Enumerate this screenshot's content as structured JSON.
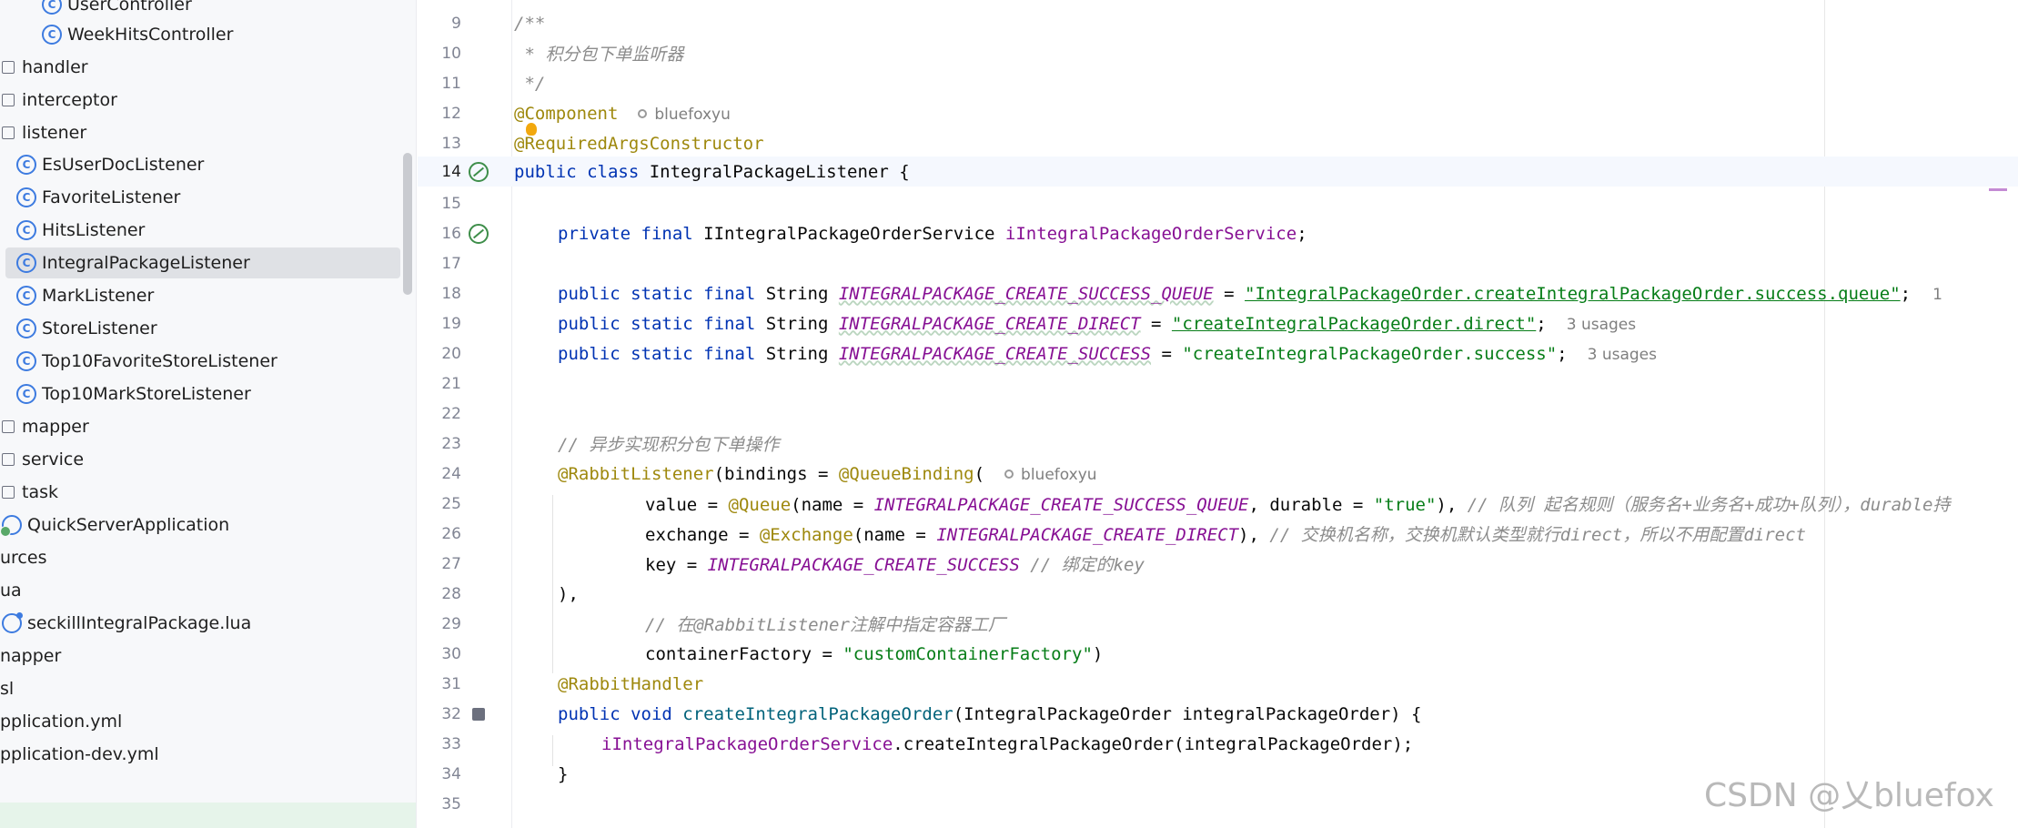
{
  "tree": {
    "items": [
      {
        "label": "UserController",
        "type": "class"
      },
      {
        "label": "WeekHitsController",
        "type": "class"
      },
      {
        "label": "handler",
        "type": "folder"
      },
      {
        "label": "interceptor",
        "type": "folder"
      },
      {
        "label": "listener",
        "type": "folder"
      },
      {
        "label": "EsUserDocListener",
        "type": "class"
      },
      {
        "label": "FavoriteListener",
        "type": "class"
      },
      {
        "label": "HitsListener",
        "type": "class"
      },
      {
        "label": "IntegralPackageListener",
        "type": "class",
        "selected": true
      },
      {
        "label": "MarkListener",
        "type": "class"
      },
      {
        "label": "StoreListener",
        "type": "class"
      },
      {
        "label": "Top10FavoriteStoreListener",
        "type": "class"
      },
      {
        "label": "Top10MarkStoreListener",
        "type": "class"
      },
      {
        "label": "mapper",
        "type": "folder"
      },
      {
        "label": "service",
        "type": "folder"
      },
      {
        "label": "task",
        "type": "folder"
      },
      {
        "label": "QuickServerApplication",
        "type": "app"
      },
      {
        "label": "urces",
        "type": "none"
      },
      {
        "label": "ua",
        "type": "none"
      },
      {
        "label": "seckillIntegralPackage.lua",
        "type": "lua"
      },
      {
        "label": "napper",
        "type": "none"
      },
      {
        "label": "sl",
        "type": "none"
      },
      {
        "label": "pplication.yml",
        "type": "none"
      },
      {
        "label": "pplication-dev.yml",
        "type": "none"
      }
    ]
  },
  "editor": {
    "line_numbers": [
      "9",
      "10",
      "11",
      "12",
      "13",
      "14",
      "15",
      "16",
      "17",
      "18",
      "19",
      "20",
      "21",
      "22",
      "23",
      "24",
      "25",
      "26",
      "27",
      "28",
      "29",
      "30",
      "31",
      "32",
      "33",
      "34",
      "35"
    ],
    "tokens": {
      "l9": "/**",
      "l10_star": " * ",
      "l10_cmt": "积分包下单监听器",
      "l11": " */",
      "l12_ann": "@Component",
      "l12_author": "bluefoxyu",
      "l13_ann": "@RequiredArgsConstructor",
      "l14_kw": "public class ",
      "l14_name": "IntegralPackageListener",
      "l14_brace": " {",
      "l16_kw": "private final ",
      "l16_type": "IIntegralPackageOrderService ",
      "l16_field": "iIntegralPackageOrderService",
      "l16_end": ";",
      "l18_kw": "public static final ",
      "l18_type": "String ",
      "l18_const": "INTEGRALPACKAGE_CREATE_SUCCESS_QUEUE",
      "l18_eq": " = ",
      "l18_str": "\"IntegralPackageOrder.createIntegralPackageOrder.success.queue\"",
      "l18_end": ";",
      "l18_hint": "1",
      "l19_kw": "public static final ",
      "l19_type": "String ",
      "l19_const": "INTEGRALPACKAGE_CREATE_DIRECT",
      "l19_eq": " = ",
      "l19_str": "\"createIntegralPackageOrder.direct\"",
      "l19_end": ";",
      "l19_hint": "3 usages",
      "l20_kw": "public static final ",
      "l20_type": "String ",
      "l20_const": "INTEGRALPACKAGE_CREATE_SUCCESS",
      "l20_eq": " = ",
      "l20_str": "\"createIntegralPackageOrder.success\"",
      "l20_end": ";",
      "l20_hint": "3 usages",
      "l23_cmt": "// 异步实现积分包下单操作",
      "l24_ann": "@RabbitListener",
      "l24_mid": "(bindings = ",
      "l24_ann2": "@QueueBinding",
      "l24_end": "(",
      "l24_author": "bluefoxyu",
      "l25_a": "value = ",
      "l25_ann": "@Queue",
      "l25_b": "(name = ",
      "l25_const": "INTEGRALPACKAGE_CREATE_SUCCESS_QUEUE",
      "l25_c": ", durable = ",
      "l25_str": "\"true\"",
      "l25_d": "), ",
      "l25_cmt": "// 队列 起名规则（服务名+业务名+成功+队列），durable持",
      "l26_a": "exchange = ",
      "l26_ann": "@Exchange",
      "l26_b": "(name = ",
      "l26_const": "INTEGRALPACKAGE_CREATE_DIRECT",
      "l26_c": "), ",
      "l26_cmt": "// 交换机名称，交换机默认类型就行direct，所以不用配置direct",
      "l27_a": "key = ",
      "l27_const": "INTEGRALPACKAGE_CREATE_SUCCESS",
      "l27_cmt": " // 绑定的key",
      "l28": "),",
      "l29_cmt": "// 在@RabbitListener注解中指定容器工厂",
      "l30_a": "containerFactory = ",
      "l30_str": "\"customContainerFactory\"",
      "l30_b": ")",
      "l31_ann": "@RabbitHandler",
      "l32_kw": "public void ",
      "l32_method": "createIntegralPackageOrder",
      "l32_rest": "(IntegralPackageOrder integralPackageOrder) {",
      "l33_field": "iIntegralPackageOrderService",
      "l33_rest": ".createIntegralPackageOrder(integralPackageOrder);",
      "l34": "}"
    }
  },
  "watermark": "CSDN @乂bluefox",
  "colors": {
    "keyword": "#0033b3",
    "annotation": "#9e880d",
    "string": "#067d17",
    "constant": "#871094",
    "comment": "#8c8c8c",
    "selection": "#dfe1e5",
    "accent": "#3d7be0"
  }
}
